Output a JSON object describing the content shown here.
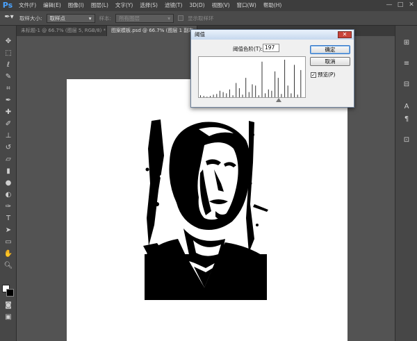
{
  "app": {
    "logo": "Ps"
  },
  "menu": [
    "文件(F)",
    "编辑(E)",
    "图像(I)",
    "图层(L)",
    "文字(Y)",
    "选择(S)",
    "滤镜(T)",
    "3D(D)",
    "视图(V)",
    "窗口(W)",
    "帮助(H)"
  ],
  "window_controls": [
    "—",
    "□",
    "✕"
  ],
  "options": {
    "sample_size_label": "取样大小:",
    "sample_size_value": "取样点",
    "sample_label": "样本:",
    "sample_value": "所有图层",
    "show_ring_label": "显示取样环"
  },
  "tabs": [
    {
      "label": "未标题-1 @ 66.7% (图层 5, RGB/8) *"
    },
    {
      "label": "图案模板.psd @ 66.7% (图层 1 副本"
    }
  ],
  "dialog": {
    "title": "阈值",
    "close_label": "✕",
    "threshold_label": "阈值色阶(T):",
    "threshold_value": "197",
    "ok_label": "确定",
    "cancel_label": "取消",
    "preview_label": "预览(P)",
    "preview_checked": true
  },
  "histogram": {
    "levels": [
      3,
      2,
      1,
      2,
      4,
      5,
      10,
      8,
      6,
      12,
      3,
      22,
      14,
      4,
      30,
      8,
      20,
      18,
      3,
      55,
      6,
      12,
      10,
      40,
      30,
      5,
      58,
      18,
      6,
      50,
      4,
      42
    ]
  },
  "colors": {
    "foreground": "#ffffff",
    "background": "#000000",
    "accent": "#4aa3ff"
  }
}
